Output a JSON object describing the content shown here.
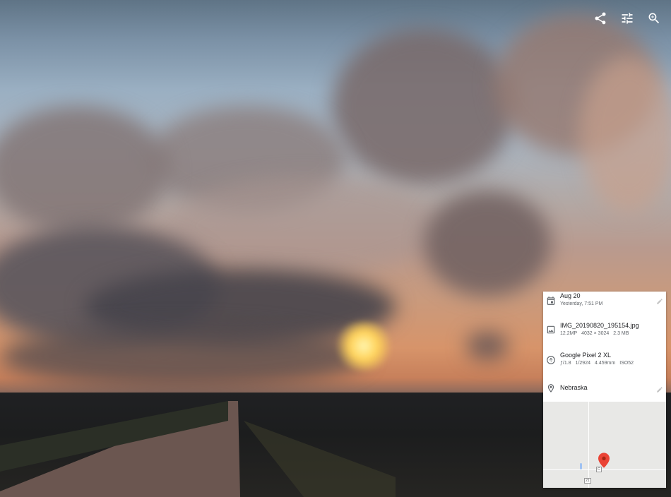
{
  "toolbar": {
    "share_icon": "share-icon",
    "edit_icon": "tune-icon",
    "zoom_icon": "zoom-in-icon"
  },
  "info": {
    "date": {
      "title": "Aug 20",
      "subtitle": "Yesterday, 7:51 PM",
      "icon": "calendar-icon"
    },
    "file": {
      "name": "IMG_20190820_195154.jpg",
      "megapixels": "12.2MP",
      "resolution": "4032 × 3024",
      "size": "2.3 MB",
      "icon": "image-icon"
    },
    "camera": {
      "model": "Google Pixel 2 XL",
      "aperture": "ƒ/1.8",
      "shutter": "1/2924",
      "focal": "4.459mm",
      "iso": "ISO52",
      "icon": "aperture-icon"
    },
    "location": {
      "name": "Nebraska",
      "icon": "location-pin-icon"
    },
    "map": {
      "route_label_1": "C",
      "route_label_2": "21"
    }
  },
  "colors": {
    "panel_bg": "#ffffff",
    "pin": "#ea4335"
  }
}
